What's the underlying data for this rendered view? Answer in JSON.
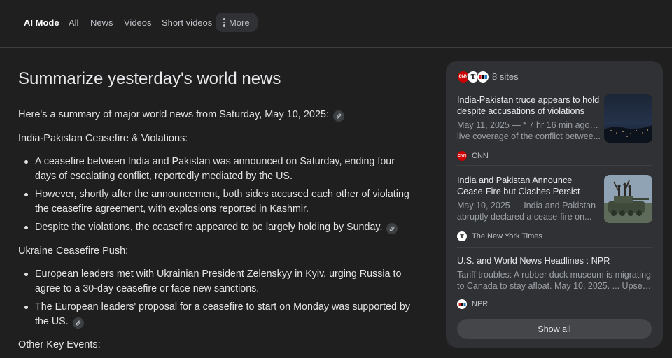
{
  "nav": {
    "tabs": [
      "AI Mode",
      "All",
      "News",
      "Videos",
      "Short videos"
    ],
    "more_label": "More"
  },
  "main": {
    "title": "Summarize yesterday's world news",
    "intro": "Here's a summary of major world news from Saturday, May 10, 2025:",
    "sections": [
      {
        "heading": "India-Pakistan Ceasefire & Violations:",
        "bullets": [
          "A ceasefire between India and Pakistan was announced on Saturday, ending four days of escalating conflict, reportedly mediated by the US.",
          "However, shortly after the announcement, both sides accused each other of violating the ceasefire agreement, with explosions reported in Kashmir.",
          "Despite the violations, the ceasefire appeared to be largely holding by Sunday."
        ]
      },
      {
        "heading": "Ukraine Ceasefire Push:",
        "bullets": [
          "European leaders met with Ukrainian President Zelenskyy in Kyiv, urging Russia to agree to a 30-day ceasefire or face new sanctions.",
          "The European leaders' proposal for a ceasefire to start on Monday was supported by the US."
        ]
      },
      {
        "heading": "Other Key Events:",
        "bullets": []
      }
    ]
  },
  "sources": {
    "count_label": "8 sites",
    "logos": [
      "CNN",
      "T",
      "NPR"
    ],
    "items": [
      {
        "title": "India-Pakistan truce appears to hold despite accusations of violations",
        "snippet": [
          "May 11, 2025 — * 7 hr 16 min ago. Our",
          "live coverage of the conflict betwee..."
        ],
        "site": "CNN",
        "favicon": "CNN"
      },
      {
        "title": "India and Pakistan Announce Cease-Fire but Clashes Persist",
        "snippet": [
          "May 10, 2025 — India and Pakistan",
          "abruptly declared a cease-fire on..."
        ],
        "site": "The New York Times",
        "favicon": "T"
      },
      {
        "title": "U.S. and World News Headlines : NPR",
        "snippet": [
          "Tariff troubles: A rubber duck museum is migrating",
          "to Canada to stay afloat. May 10, 2025. ... Upset by..."
        ],
        "site": "NPR",
        "favicon": "NPR"
      }
    ],
    "show_all_label": "Show all"
  },
  "colors": {
    "background": "#1f1f1f",
    "panel": "#303134",
    "cnn_red": "#cc0000",
    "npr_red": "#d62021",
    "npr_blue": "#237bbd"
  }
}
